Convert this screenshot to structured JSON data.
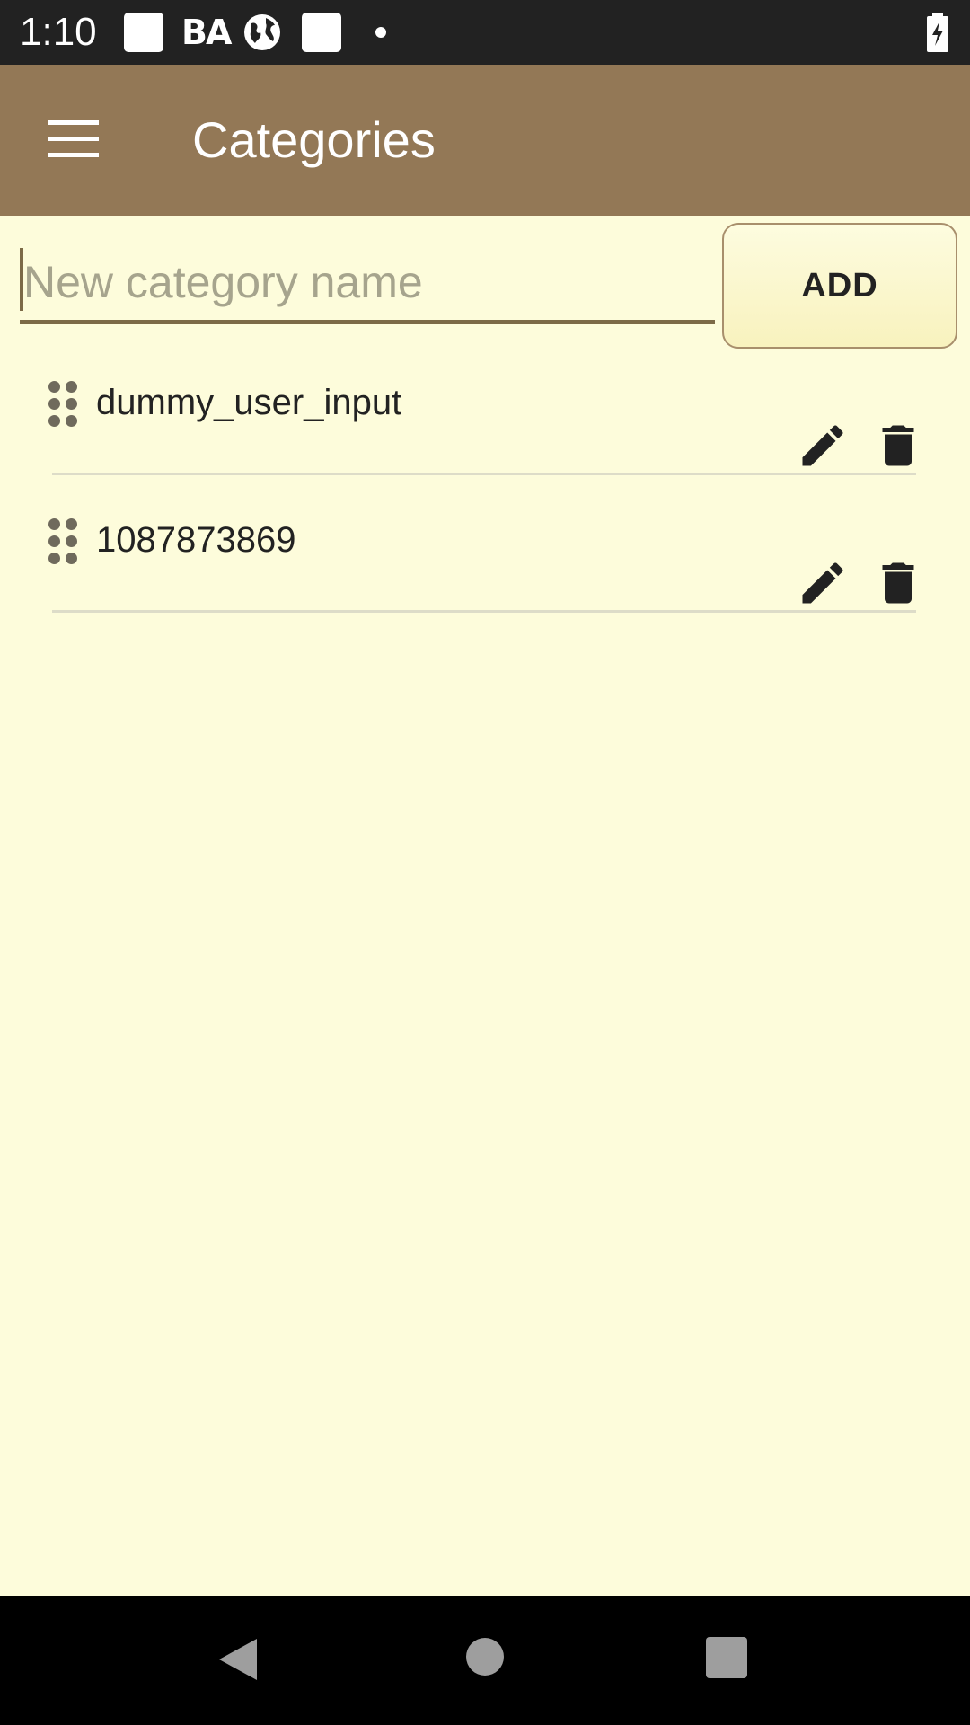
{
  "status_bar": {
    "time": "1:10",
    "ba_text": "BA",
    "icons": [
      "notification-square-icon",
      "globe-icon",
      "notification-square-icon",
      "dot-icon",
      "battery-charging-icon"
    ]
  },
  "app_bar": {
    "title": "Categories",
    "menu_icon": "hamburger-menu-icon"
  },
  "new_category": {
    "placeholder": "New category name",
    "value": "",
    "add_label": "ADD"
  },
  "categories": [
    {
      "name": "dummy_user_input"
    },
    {
      "name": "1087873869"
    }
  ],
  "colors": {
    "app_bar": "#937856",
    "background": "#fdfcdb",
    "status_bar": "#222222",
    "nav_bar": "#000000",
    "accent": "#7c6a47"
  }
}
